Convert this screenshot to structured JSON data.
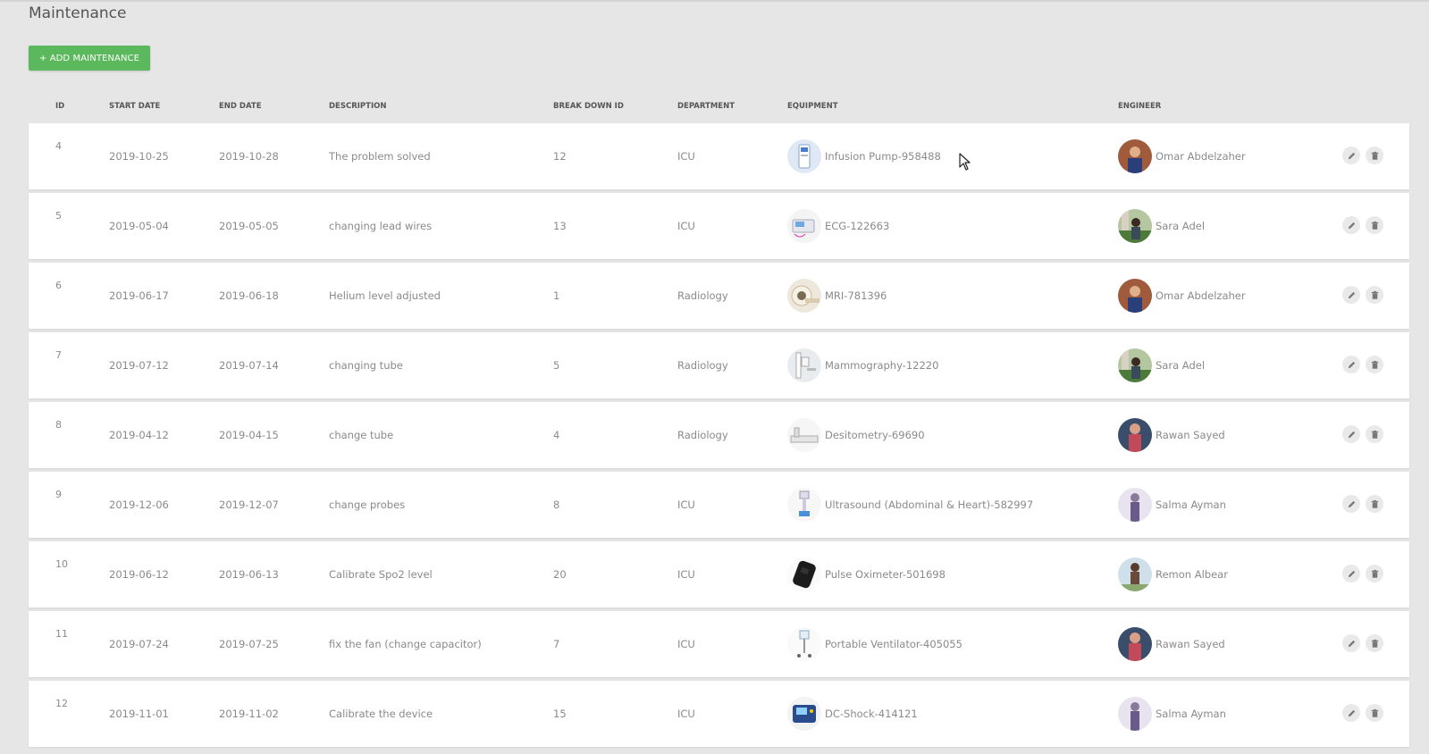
{
  "page": {
    "title": "Maintenance"
  },
  "toolbar": {
    "add_label": "+ ADD MAINTENANCE"
  },
  "columns": {
    "id": "ID",
    "start_date": "START DATE",
    "end_date": "END DATE",
    "description": "DESCRIPTION",
    "break_down_id": "BREAK DOWN ID",
    "department": "DEPARTMENT",
    "equipment": "EQUIPMENT",
    "engineer": "ENGINEER"
  },
  "rows": [
    {
      "id": "4",
      "start": "2019-10-25",
      "end": "2019-10-28",
      "description": "The problem solved",
      "breakdown": "12",
      "department": "ICU",
      "equipment": "Infusion Pump-958488",
      "engineer": "Omar Abdelzaher"
    },
    {
      "id": "5",
      "start": "2019-05-04",
      "end": "2019-05-05",
      "description": "changing lead wires",
      "breakdown": "13",
      "department": "ICU",
      "equipment": "ECG-122663",
      "engineer": "Sara Adel"
    },
    {
      "id": "6",
      "start": "2019-06-17",
      "end": "2019-06-18",
      "description": "Helium level adjusted",
      "breakdown": "1",
      "department": "Radiology",
      "equipment": "MRI-781396",
      "engineer": "Omar Abdelzaher"
    },
    {
      "id": "7",
      "start": "2019-07-12",
      "end": "2019-07-14",
      "description": "changing tube",
      "breakdown": "5",
      "department": "Radiology",
      "equipment": "Mammography-12220",
      "engineer": "Sara Adel"
    },
    {
      "id": "8",
      "start": "2019-04-12",
      "end": "2019-04-15",
      "description": "change tube",
      "breakdown": "4",
      "department": "Radiology",
      "equipment": "Desitometry-69690",
      "engineer": "Rawan Sayed"
    },
    {
      "id": "9",
      "start": "2019-12-06",
      "end": "2019-12-07",
      "description": "change probes",
      "breakdown": "8",
      "department": "ICU",
      "equipment": "Ultrasound (Abdominal & Heart)-582997",
      "engineer": "Salma Ayman"
    },
    {
      "id": "10",
      "start": "2019-06-12",
      "end": "2019-06-13",
      "description": "Calibrate Spo2 level",
      "breakdown": "20",
      "department": "ICU",
      "equipment": "Pulse Oximeter-501698",
      "engineer": "Remon Albear"
    },
    {
      "id": "11",
      "start": "2019-07-24",
      "end": "2019-07-25",
      "description": "fix the fan (change capacitor)",
      "breakdown": "7",
      "department": "ICU",
      "equipment": "Portable Ventilator-405055",
      "engineer": "Rawan Sayed"
    },
    {
      "id": "12",
      "start": "2019-11-01",
      "end": "2019-11-02",
      "description": "Calibrate the device",
      "breakdown": "15",
      "department": "ICU",
      "equipment": "DC-Shock-414121",
      "engineer": "Salma Ayman"
    }
  ],
  "icons": {
    "edit": "pencil-icon",
    "delete": "trash-icon"
  },
  "colors": {
    "accent": "#5cb85c",
    "background": "#e6e6e6",
    "row": "#ffffff"
  }
}
